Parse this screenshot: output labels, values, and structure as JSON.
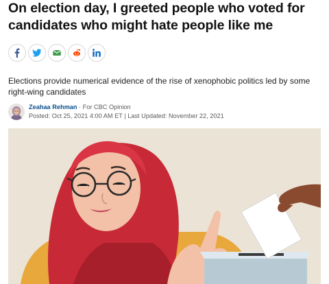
{
  "article": {
    "headline": "On election day, I greeted people who voted for candidates who might hate people like me",
    "dek": "Elections provide numerical evidence of the rise of xenophobic politics led by some right-wing candidates",
    "author": "Zeahaa Rehman",
    "section_prefix": "·",
    "section": "For CBC Opinion",
    "posted": "Posted: Oct 25, 2021 4:00 AM ET",
    "separator": "|",
    "updated": "Last Updated: November 22, 2021"
  },
  "share": {
    "icons": [
      "facebook-icon",
      "twitter-icon",
      "email-icon",
      "reddit-icon",
      "linkedin-icon"
    ]
  },
  "colors": {
    "link": "#0a4f8f",
    "facebook": "#3b5998",
    "twitter": "#1da1f2",
    "email": "#3c9a4a",
    "reddit": "#ff4500",
    "linkedin": "#0a66c2",
    "illustration_bg": "#ebe4d6",
    "hijab": "#c72a36",
    "skin": "#f2c1a8"
  }
}
